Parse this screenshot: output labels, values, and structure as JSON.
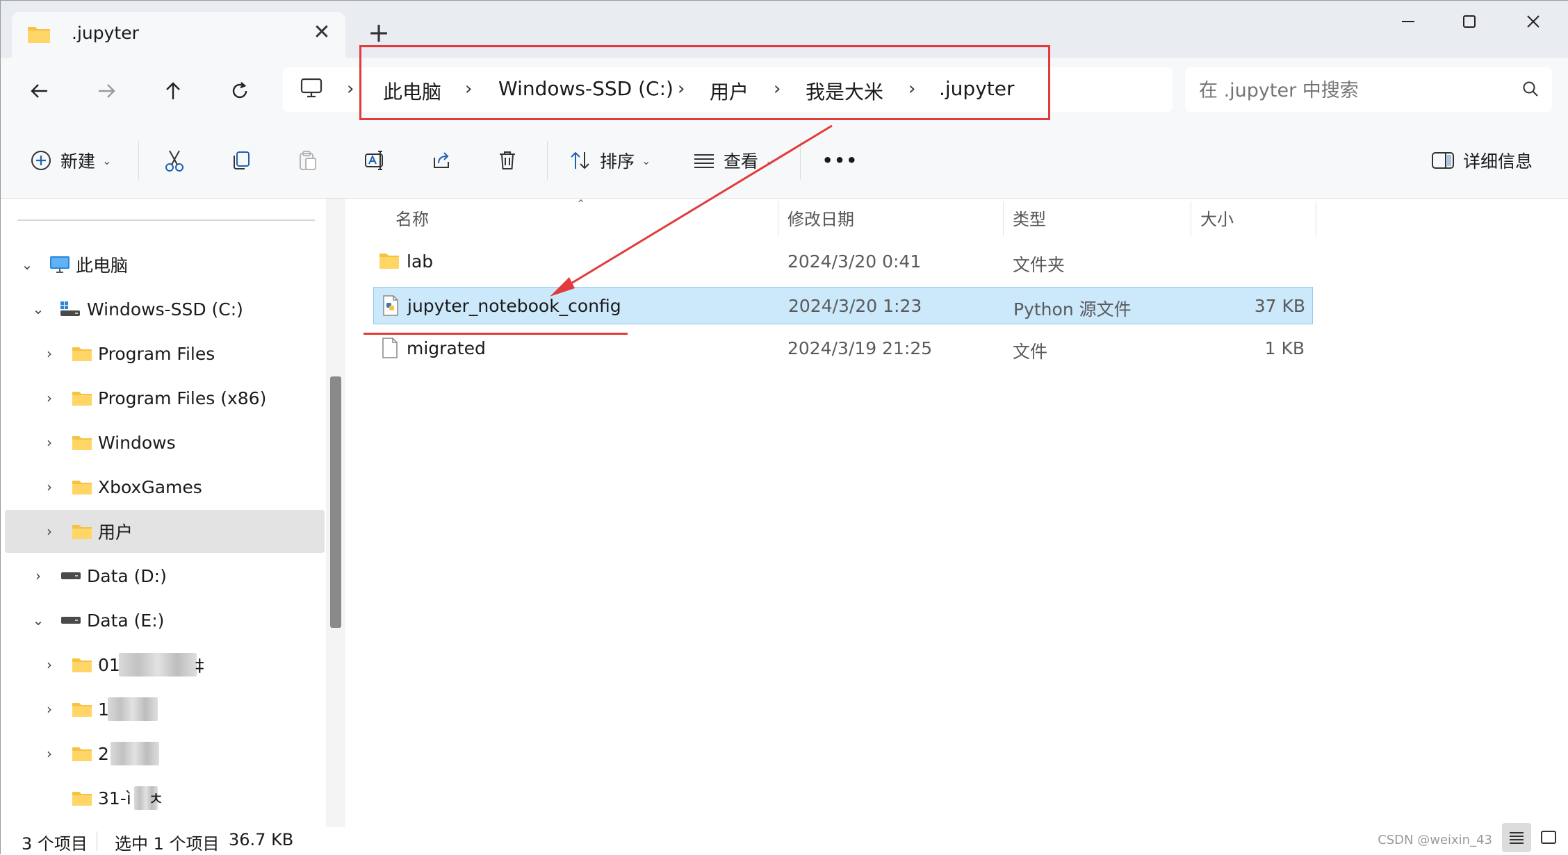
{
  "tab": {
    "title": ".jupyter",
    "close": "✕",
    "new_tab": "+"
  },
  "window_controls": {
    "minimize": "minimize-icon",
    "maximize": "maximize-icon",
    "close": "close-icon"
  },
  "nav": {
    "back": "back-arrow-icon",
    "forward": "forward-arrow-icon",
    "up": "up-arrow-icon",
    "refresh": "refresh-icon"
  },
  "breadcrumb": [
    "此电脑",
    "Windows-SSD (C:)",
    "用户",
    "我是大米",
    ".jupyter"
  ],
  "search": {
    "placeholder": "在 .jupyter 中搜索"
  },
  "toolbar": {
    "new_label": "新建",
    "sort_label": "排序",
    "view_label": "查看",
    "more": "•••",
    "details_label": "详细信息"
  },
  "sidebar": {
    "items": [
      {
        "label": "此电脑",
        "icon": "monitor-icon",
        "expanded": true
      },
      {
        "label": "Windows-SSD (C:)",
        "icon": "drive-icon",
        "expanded": true
      },
      {
        "label": "Program Files",
        "icon": "folder-icon"
      },
      {
        "label": "Program Files (x86)",
        "icon": "folder-icon"
      },
      {
        "label": "Windows",
        "icon": "folder-icon"
      },
      {
        "label": "XboxGames",
        "icon": "folder-icon"
      },
      {
        "label": "用户",
        "icon": "folder-icon",
        "selected": true
      },
      {
        "label": "Data (D:)",
        "icon": "drive-icon"
      },
      {
        "label": "Data (E:)",
        "icon": "drive-icon",
        "expanded": true
      },
      {
        "label": "01",
        "icon": "folder-icon",
        "suffix": "‡"
      },
      {
        "label": "1",
        "icon": "folder-icon"
      },
      {
        "label": "2",
        "icon": "folder-icon"
      },
      {
        "label": "31-ì",
        "icon": "folder-icon",
        "suffix": "ㅊ"
      }
    ]
  },
  "columns": {
    "name": "名称",
    "modified": "修改日期",
    "type": "类型",
    "size": "大小"
  },
  "files": [
    {
      "name": "lab",
      "modified": "2024/3/20 0:41",
      "type": "文件夹",
      "size": "",
      "icon": "folder-icon"
    },
    {
      "name": "jupyter_notebook_config",
      "modified": "2024/3/20 1:23",
      "type": "Python 源文件",
      "size": "37 KB",
      "icon": "python-file-icon",
      "selected": true
    },
    {
      "name": "migrated",
      "modified": "2024/3/19 21:25",
      "type": "文件",
      "size": "1 KB",
      "icon": "file-icon"
    }
  ],
  "status": {
    "count": "3 个项目",
    "selection": "选中 1 个项目",
    "sel_size": "36.7 KB"
  },
  "watermark": "CSDN @weixin_43",
  "colors": {
    "selection": "#cce8fb",
    "annotation_red": "#e23b3b",
    "folder": "#f5c242"
  }
}
